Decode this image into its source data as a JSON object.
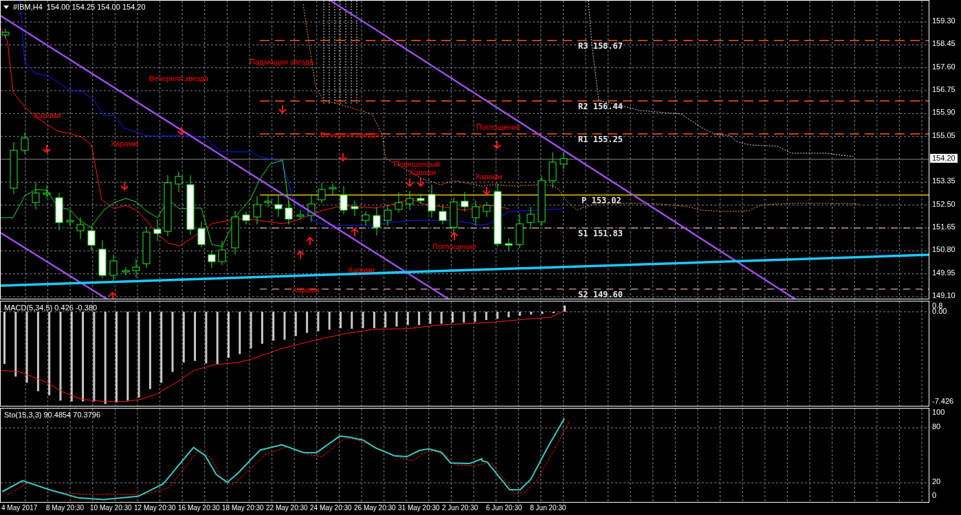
{
  "chart": {
    "symbol": "#IBM,H4",
    "ohlc": "154.00 154.25 154.00 154.20",
    "price_axis": [
      "159.30",
      "158.45",
      "157.60",
      "156.75",
      "155.90",
      "155.05",
      "153.35",
      "152.50",
      "151.65",
      "150.80",
      "149.95",
      "149.10"
    ],
    "current_price": "154.20",
    "pivots": [
      {
        "label": "R3 158.67",
        "kind": "resistance"
      },
      {
        "label": "R2 156.44",
        "kind": "resistance"
      },
      {
        "label": "R1 155.25",
        "kind": "resistance"
      },
      {
        "label": "P 153.02",
        "kind": "pivot"
      },
      {
        "label": "S1 151.83",
        "kind": "support"
      },
      {
        "label": "S2 149.60",
        "kind": "support"
      }
    ],
    "pattern_labels": [
      "Падающая звезда",
      "Вечерняя звезда",
      "Харами",
      "Харами",
      "Вечерняя звезда",
      "Повешенный",
      "Харами",
      "Поглощение",
      "Харами",
      "Поглощение",
      "Харами",
      "Харами"
    ]
  },
  "macd": {
    "label": "MACD(5,34,5) 0.426 -0.380",
    "axis": [
      "0.8",
      "0.00",
      "-7.426"
    ]
  },
  "stochastic": {
    "label": "Sto(15,3,3) 90.4854 70.3796",
    "axis": [
      "100",
      "80",
      "20",
      "0"
    ]
  },
  "time_axis": [
    "4 May 2017",
    "8 May 20:30",
    "10 May 20:30",
    "12 May 20:30",
    "16 May 20:30",
    "18 May 20:30",
    "22 May 20:30",
    "24 May 20:30",
    "26 May 20:30",
    "31 May 20:30",
    "2 Jun 20:30",
    "6 Jun 20:30",
    "8 Jun 20:30"
  ]
}
